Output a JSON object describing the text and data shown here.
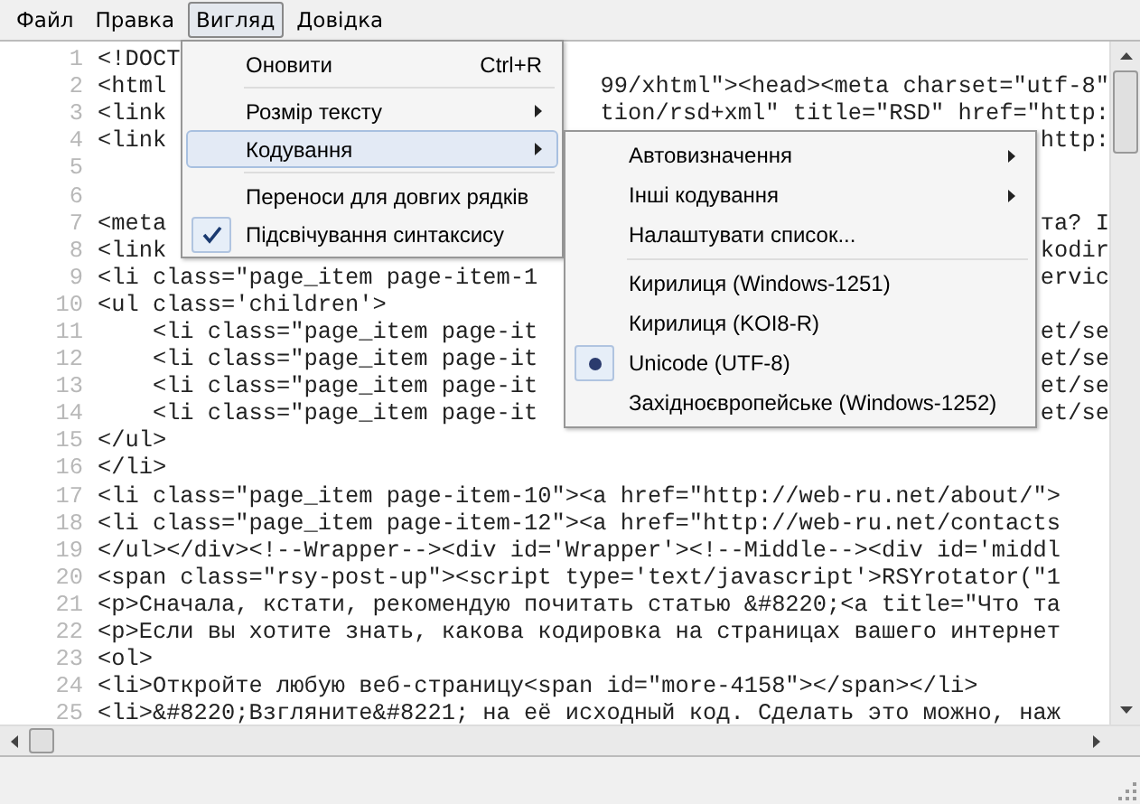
{
  "menubar": [
    {
      "label": "Файл",
      "open": false
    },
    {
      "label": "Правка",
      "open": false
    },
    {
      "label": "Вигляд",
      "open": true
    },
    {
      "label": "Довідка",
      "open": false
    }
  ],
  "lines": [
    {
      "num": "1",
      "left": "<!DOCT"
    },
    {
      "num": "2",
      "left": "<html",
      "right": "99/xhtml\"><head><meta charset=\"utf-8\""
    },
    {
      "num": "3",
      "left": "<link",
      "right": "tion/rsd+xml\" title=\"RSD\" href=\"http:"
    },
    {
      "num": "4",
      "left": "<link",
      "right": "http:"
    },
    {
      "num": "5"
    },
    {
      "num": "6"
    },
    {
      "num": "7",
      "left": "<meta",
      "right": "та? I"
    },
    {
      "num": "8",
      "left": "<link",
      "right": "kodir"
    },
    {
      "num": "9",
      "left": "<li class=\"page_item page-item-1",
      "right": "ervic"
    },
    {
      "num": "10",
      "left": "<ul class='children'>"
    },
    {
      "num": "11",
      "left": "    <li class=\"page_item page-it",
      "right": "et/se"
    },
    {
      "num": "12",
      "left": "    <li class=\"page_item page-it",
      "right": "et/se"
    },
    {
      "num": "13",
      "left": "    <li class=\"page_item page-it",
      "right": "et/se"
    },
    {
      "num": "14",
      "left": "    <li class=\"page_item page-it",
      "right": "et/se"
    },
    {
      "num": "15",
      "left": "</ul>"
    },
    {
      "num": "16",
      "left": "</li>"
    },
    {
      "num": "17",
      "left": "<li class=\"page_item page-item-10\"><a href=\"http://web-ru.net/about/\">"
    },
    {
      "num": "18",
      "left": "<li class=\"page_item page-item-12\"><a href=\"http://web-ru.net/contacts"
    },
    {
      "num": "19",
      "left": "</ul></div><!--Wrapper--><div id='Wrapper'><!--Middle--><div id='middl"
    },
    {
      "num": "20",
      "left": "<span class=\"rsy-post-up\"><script type='text/javascript'>RSYrotator(\"1"
    },
    {
      "num": "21",
      "left": "<p>Сначала, кстати, рекомендую почитать статью &#8220;<a title=\"Что та"
    },
    {
      "num": "22",
      "left": "<p>Если вы хотите знать, какова кодировка на страницах вашего интернет"
    },
    {
      "num": "23",
      "left": "<ol>"
    },
    {
      "num": "24",
      "left": "<li>Откройте любую веб-страницу<span id=\"more-4158\"></span></li>"
    },
    {
      "num": "25",
      "left": "<li>&#8220;Взгляните&#8221; на её исходный код. Сделать это можно, наж"
    }
  ],
  "view_menu": [
    {
      "kind": "command",
      "label": "Оновити",
      "shortcut": "Ctrl+R",
      "selected": false
    },
    {
      "kind": "separator"
    },
    {
      "kind": "submenu",
      "label": "Розмір тексту",
      "selected": false
    },
    {
      "kind": "submenu",
      "label": "Кодування",
      "selected": true
    },
    {
      "kind": "separator"
    },
    {
      "kind": "check",
      "label": "Переноси для довгих рядків",
      "checked": false,
      "selected": false
    },
    {
      "kind": "check",
      "label": "Підсвічування синтаксису",
      "checked": true,
      "selected": false
    }
  ],
  "encoding_menu": [
    {
      "kind": "submenu",
      "label": "Автовизначення"
    },
    {
      "kind": "submenu",
      "label": "Інші кодування"
    },
    {
      "kind": "command",
      "label": "Налаштувати список..."
    },
    {
      "kind": "separator"
    },
    {
      "kind": "radio",
      "label": "Кирилиця (Windows-1251)",
      "selected": false
    },
    {
      "kind": "radio",
      "label": "Кирилиця (KOI8-R)",
      "selected": false
    },
    {
      "kind": "radio",
      "label": "Unicode (UTF-8)",
      "selected": true
    },
    {
      "kind": "radio",
      "label": "Західноєвропейське (Windows-1252)",
      "selected": false
    }
  ]
}
